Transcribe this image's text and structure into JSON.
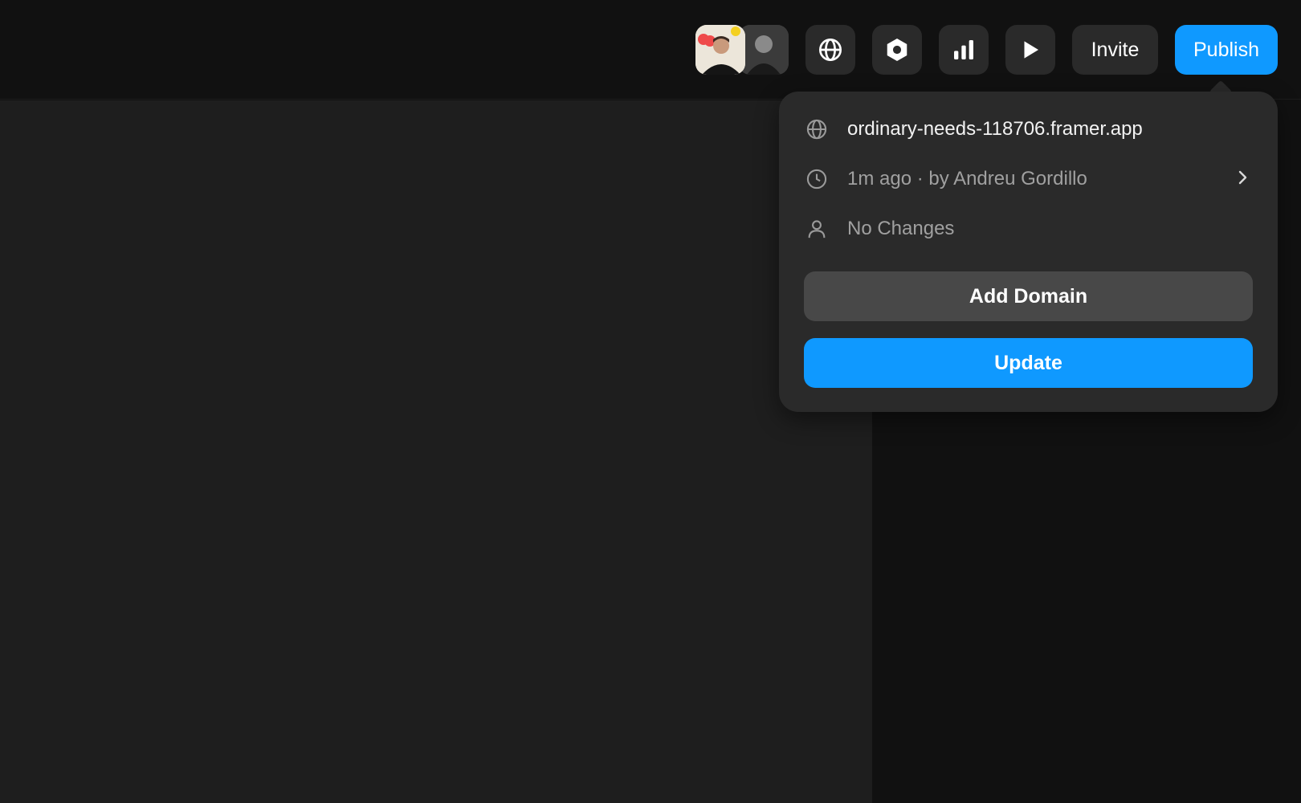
{
  "toolbar": {
    "invite_label": "Invite",
    "publish_label": "Publish",
    "icons": [
      "globe-icon",
      "hexagon-settings-icon",
      "bar-chart-icon",
      "play-icon"
    ]
  },
  "collaborators": [
    "avatar-1",
    "avatar-2"
  ],
  "publish_popover": {
    "domain": "ordinary-needs-118706.framer.app",
    "last_published": "1m ago · by Andreu Gordillo",
    "changes_status": "No Changes",
    "add_domain_label": "Add Domain",
    "update_label": "Update"
  },
  "colors": {
    "accent": "#0f99ff",
    "topbar_bg": "#111111",
    "canvas_bg": "#1e1e1e",
    "popover_bg": "#2a2a2a",
    "secondary_button": "#484848"
  }
}
